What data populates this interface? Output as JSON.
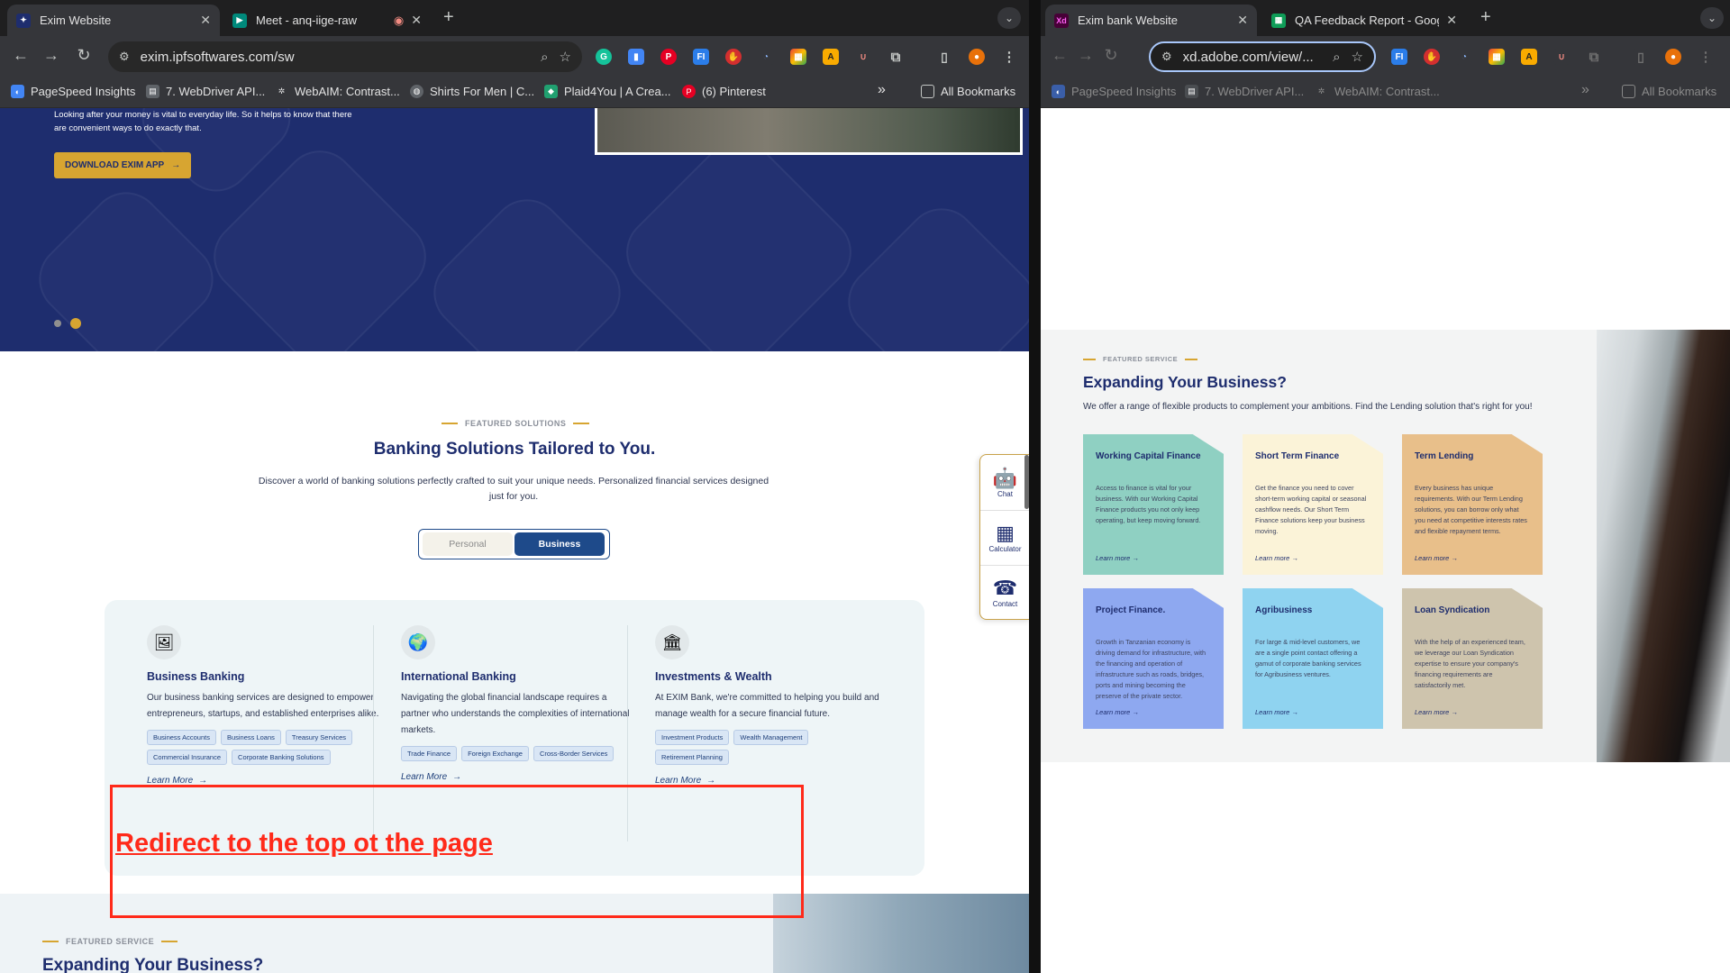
{
  "left_window": {
    "tabs": [
      {
        "title": "Exim Website",
        "favicon": "exim-icon",
        "active": true
      },
      {
        "title": "Meet - anq-iige-raw",
        "favicon": "google-meet-icon",
        "recording": true,
        "active": false
      }
    ],
    "new_tab_symbol": "+",
    "url": "exim.ipfsoftwares.com/sw",
    "bookmarks": [
      {
        "label": "PageSpeed Insights",
        "icon": "pagespeed-icon"
      },
      {
        "label": "7. WebDriver API...",
        "icon": "doc-icon"
      },
      {
        "label": "WebAIM: Contrast...",
        "icon": "webaim-icon"
      },
      {
        "label": "Shirts For Men | C...",
        "icon": "globe-icon"
      },
      {
        "label": "Plaid4You | A Crea...",
        "icon": "tag-icon"
      },
      {
        "label": "(6) Pinterest",
        "icon": "pinterest-icon"
      }
    ],
    "more_bookmarks": "»",
    "all_bookmarks": "All Bookmarks",
    "page": {
      "hero_text": "Looking after your money is vital to everyday life. So it helps to know that there are convenient ways to do exactly that.",
      "download_button": "DOWNLOAD EXIM APP",
      "carousel_dots": 2,
      "eyebrow": "FEATURED SOLUTIONS",
      "title": "Banking Solutions Tailored to You.",
      "description": "Discover a world of banking solutions perfectly crafted to suit your unique needs. Personalized financial services designed just for you.",
      "toggle": {
        "personal": "Personal",
        "business": "Business",
        "selected": "Business"
      },
      "columns": [
        {
          "icon": "presentation-icon",
          "title": "Business Banking",
          "description": "Our business banking services are designed to empower entrepreneurs, startups, and established enterprises alike.",
          "tags": [
            "Business Accounts",
            "Business Loans",
            "Treasury Services",
            "Commercial Insurance",
            "Corporate Banking Solutions"
          ],
          "learn_more": "Learn More"
        },
        {
          "icon": "globe-icon",
          "title": "International Banking",
          "description": "Navigating the global financial landscape requires a partner who understands the complexities of international markets.",
          "tags": [
            "Trade Finance",
            "Foreign Exchange",
            "Cross-Border Services"
          ],
          "learn_more": "Learn More"
        },
        {
          "icon": "bank-icon",
          "title": "Investments & Wealth",
          "description": "At EXIM Bank, we're committed to helping you build and manage wealth for a secure financial future.",
          "tags": [
            "Investment Products",
            "Wealth Management",
            "Retirement Planning"
          ],
          "learn_more": "Learn More"
        }
      ],
      "annotation": "Redirect to the top ot the page",
      "next_section": {
        "eyebrow": "FEATURED SERVICE",
        "title": "Expanding Your Business?"
      },
      "widget": [
        {
          "label": "Chat",
          "icon": "robot-icon"
        },
        {
          "label": "Calculator",
          "icon": "calculator-icon"
        },
        {
          "label": "Contact",
          "icon": "phone-icon"
        }
      ]
    }
  },
  "right_window": {
    "tabs": [
      {
        "title": "Exim bank Website",
        "favicon": "adobe-xd-icon",
        "active": true
      },
      {
        "title": "QA Feedback Report - Googl",
        "favicon": "google-sheets-icon",
        "active": false
      }
    ],
    "new_tab_symbol": "+",
    "url": "xd.adobe.com/view/...",
    "bookmarks": [
      {
        "label": "PageSpeed Insights",
        "icon": "pagespeed-icon"
      },
      {
        "label": "7. WebDriver API...",
        "icon": "doc-icon"
      },
      {
        "label": "WebAIM: Contrast...",
        "icon": "webaim-icon"
      }
    ],
    "more_bookmarks": "»",
    "all_bookmarks": "All Bookmarks",
    "artboard": {
      "eyebrow": "FEATURED SERVICE",
      "title": "Expanding Your Business?",
      "description": "We offer a range of flexible products to complement your ambitions. Find the Lending solution that's right for you!",
      "cards": [
        {
          "title": "Working Capital Finance",
          "text": "Access to finance is vital for your business. With our Working Capital Finance products you not only keep operating, but keep moving forward.",
          "link": "Learn more",
          "color": "#8fd0c2"
        },
        {
          "title": "Short Term Finance",
          "text": "Get the finance you need to cover short-term working capital or seasonal cashflow needs. Our Short Term Finance solutions keep your business moving.",
          "link": "Learn more",
          "color": "#fbf3d8"
        },
        {
          "title": "Term Lending",
          "text": "Every business has unique requirements. With our Term Lending solutions, you can borrow only what you need at competitive interests rates and flexible repayment terms.",
          "link": "Learn more",
          "color": "#e8bf8a"
        },
        {
          "title": "Project Finance.",
          "text": "Growth in Tanzanian economy is driving demand for infrastructure, with the financing and operation of infrastructure such as roads, bridges, ports and mining becoming the preserve of the private sector.",
          "link": "Learn more",
          "color": "#8ea8f0"
        },
        {
          "title": "Agribusiness",
          "text": "For large & mid-level customers, we are a single point contact offering a gamut of corporate banking services for Agribusiness ventures.",
          "link": "Learn more",
          "color": "#8fd3f0"
        },
        {
          "title": "Loan Syndication",
          "text": "With the help of an experienced team, we leverage our Loan Syndication expertise to ensure your company's financing requirements are satisfactorily met.",
          "link": "Learn more",
          "color": "#cec4ad"
        }
      ]
    }
  }
}
